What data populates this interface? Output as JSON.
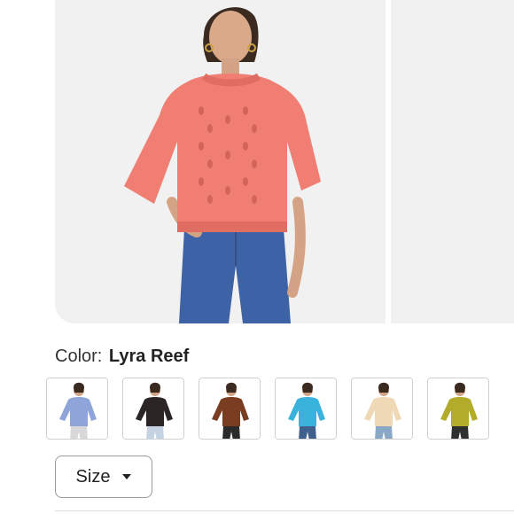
{
  "product": {
    "color_label": "Color:",
    "color_value": "Lyra Reef",
    "main_sweater_color": "#f07e72",
    "swatches": [
      {
        "name": "periwinkle",
        "color": "#8fa4d8",
        "pants": "#d8d8d8"
      },
      {
        "name": "black",
        "color": "#2b2526",
        "pants": "#c4d2e2"
      },
      {
        "name": "brown",
        "color": "#7a3d22",
        "pants": "#2a2a2a"
      },
      {
        "name": "aqua",
        "color": "#3ab3dc",
        "pants": "#3f5f8c"
      },
      {
        "name": "cream",
        "color": "#efd8b6",
        "pants": "#8aa8c6"
      },
      {
        "name": "olive",
        "color": "#b3ac2a",
        "pants": "#2f2f2f"
      }
    ]
  },
  "size_selector": {
    "label": "Size"
  }
}
